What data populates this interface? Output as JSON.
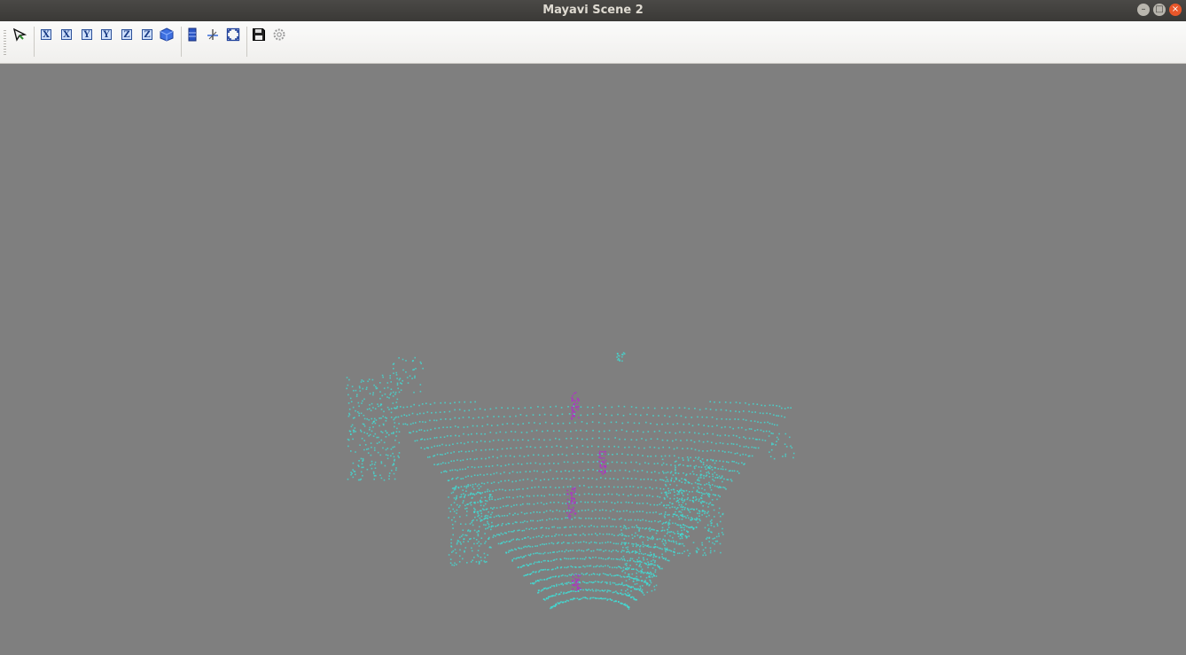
{
  "window": {
    "title": "Mayavi Scene 2"
  },
  "window_controls": {
    "minimize": "–",
    "maximize": "□",
    "close": "×"
  },
  "toolbar": {
    "items": [
      {
        "name": "pipeline-selector",
        "icon": "cursor-arrow-icon"
      },
      {
        "name": "view-x-positive",
        "label": "X"
      },
      {
        "name": "view-x-negative",
        "label": "X"
      },
      {
        "name": "view-y-positive",
        "label": "Y"
      },
      {
        "name": "view-y-negative",
        "label": "Y"
      },
      {
        "name": "view-z-positive",
        "label": "Z"
      },
      {
        "name": "view-z-negative",
        "label": "Z"
      },
      {
        "name": "isometric-view",
        "icon": "cube-icon"
      },
      {
        "name": "toggle-parallel-projection",
        "icon": "parallel-projection-icon"
      },
      {
        "name": "toggle-axes",
        "icon": "axes-indicator-icon"
      },
      {
        "name": "full-screen",
        "icon": "fullscreen-icon"
      },
      {
        "name": "save-scene",
        "icon": "floppy-disk-icon"
      },
      {
        "name": "scene-settings",
        "icon": "gear-icon"
      }
    ]
  },
  "scene": {
    "background": "#7f7f7f",
    "point_cloud": {
      "primary_color": "#3ee0d8",
      "highlight_color": "#b030c8"
    }
  }
}
